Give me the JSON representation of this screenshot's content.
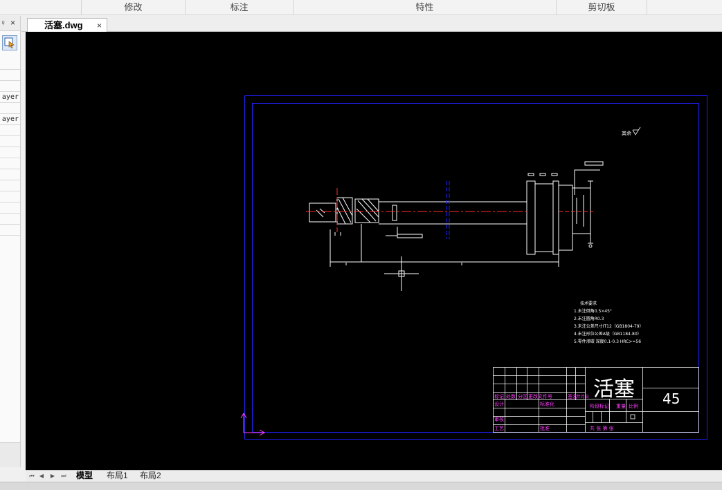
{
  "ribbon": {
    "groups": [
      "修改",
      "标注",
      "特性",
      "剪切板"
    ]
  },
  "left_panel": {
    "pin_glyph": "♀",
    "close_glyph": "×",
    "rows": [
      "ayer",
      "ayer"
    ]
  },
  "document_tab": {
    "title": "活塞.dwg",
    "close_glyph": "×"
  },
  "layout_tabs": [
    "模型",
    "布局1",
    "布局2"
  ],
  "drawing": {
    "roughness_note": "其余",
    "tech_req_title": "技术要求",
    "tech_req": [
      "1.未注倒角0.5×45°",
      "2.未注圆角R0.3",
      "3.未注公差尺寸IT12（GB1804-79）",
      "4.未注形位公差A级（GB1184-80）",
      "5.零件渗碳  深度0.1-0.3 HRC>=56"
    ],
    "title_block": {
      "part_name": "活塞",
      "material": "45",
      "row_labels": [
        "标记",
        "处数",
        "分区",
        "更改文件号",
        "签名",
        "年月日"
      ],
      "design": "设计",
      "standardize": "标准化",
      "review": "审核",
      "process": "工艺",
      "approve": "批准",
      "stage_mark": "阶段标记",
      "weight": "重量",
      "scale": "比例",
      "sheet_info": "共  张  第  张"
    }
  },
  "colors": {
    "canvas": "#000000",
    "frame": "#0000ff",
    "lines": "#ffffff",
    "center": "#ff0000",
    "annotation": "#ff00ff",
    "ucs": "#ff00ff"
  }
}
